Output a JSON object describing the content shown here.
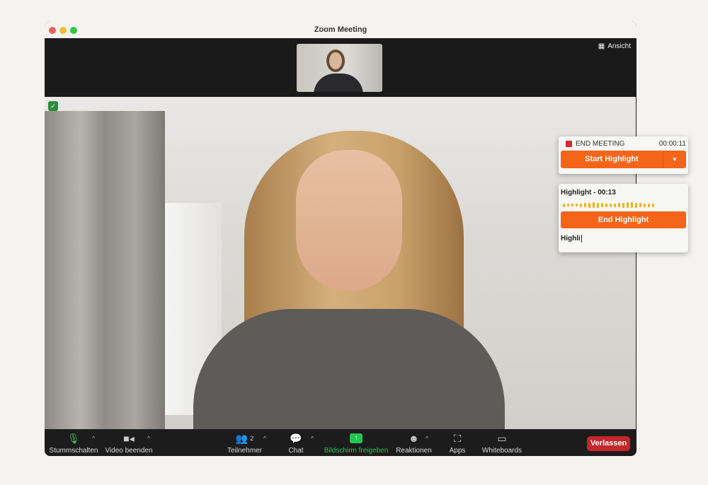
{
  "window": {
    "title": "Zoom Meeting"
  },
  "top": {
    "view_label": "Ansicht"
  },
  "toolbar": {
    "mute": "Stummschalten",
    "video": "Video beenden",
    "participants": "Teilnehmer",
    "participant_count": "2",
    "chat": "Chat",
    "share": "Bildschirm freigeben",
    "reactions": "Reaktionen",
    "apps": "Apps",
    "whiteboards": "Whiteboards",
    "leave": "Verlassen"
  },
  "colors": {
    "accent": "#f4651a",
    "share_green": "#23c552",
    "leave_red": "#c6262b",
    "mic_green": "#2fd05a",
    "end_red": "#d9282f",
    "wave": "#f2b20f"
  },
  "panel1": {
    "end_meeting": "END MEETING",
    "timer": "00:00:11",
    "start_highlight": "Start Highlight"
  },
  "panel2": {
    "title": "Highlight - 00:13",
    "end_highlight": "End Highlight",
    "input_value": "Highli"
  }
}
